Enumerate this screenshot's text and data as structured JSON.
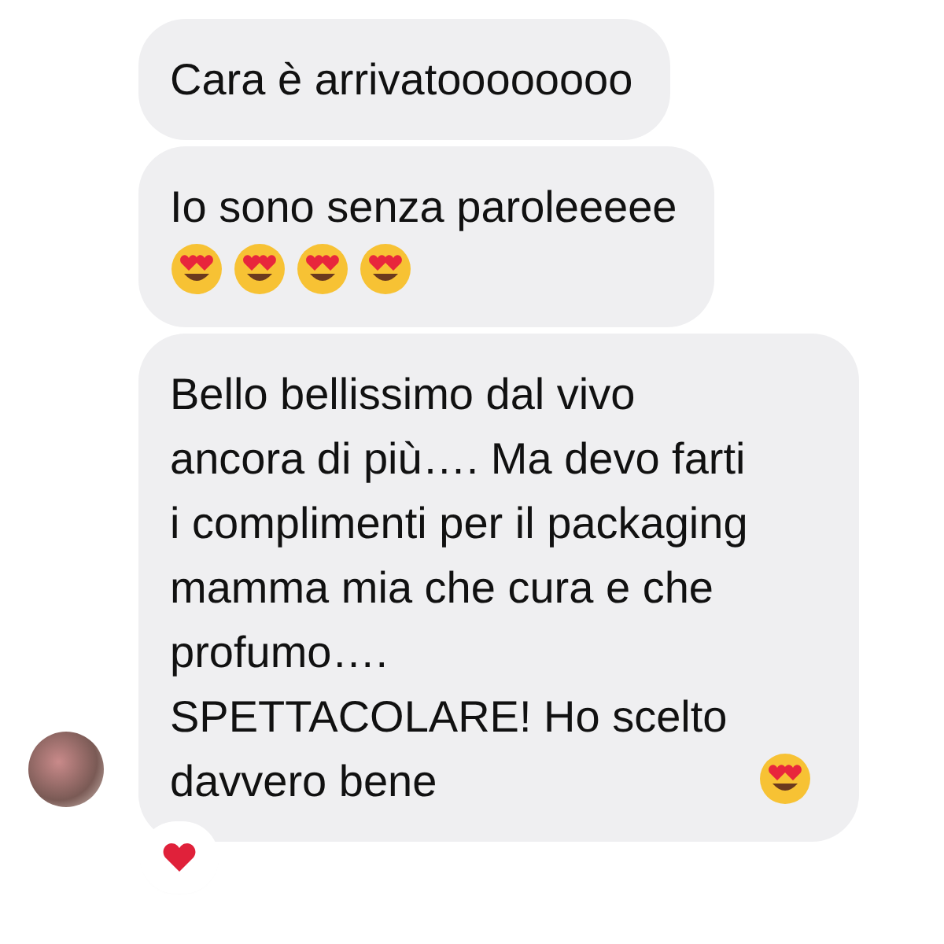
{
  "messages": [
    {
      "text": "Cara è arrivatoooooooo"
    },
    {
      "text": "Io sono senza paroleeeee",
      "emojis": [
        {
          "kind": "heart-eyes"
        },
        {
          "kind": "heart-eyes"
        },
        {
          "kind": "heart-eyes"
        },
        {
          "kind": "heart-eyes"
        }
      ]
    },
    {
      "text": "Bello bellissimo dal vivo ancora di più…. Ma devo farti i complimenti per il packaging mamma mia che cura e che profumo…. SPETTACOLARE! Ho scelto davvero bene",
      "emojis": [
        {
          "kind": "heart-eyes"
        }
      ],
      "reaction": {
        "kind": "heart"
      }
    }
  ]
}
